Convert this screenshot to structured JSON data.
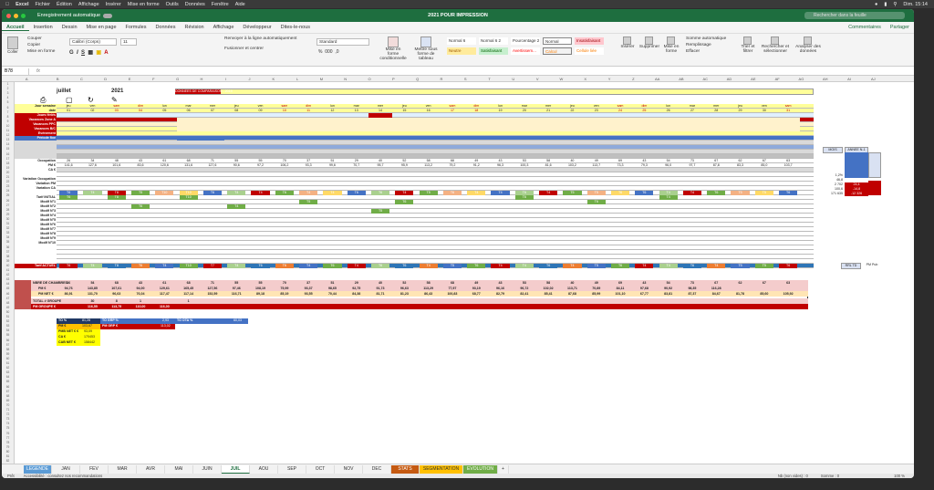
{
  "menubar": {
    "app": "Excel",
    "items": [
      "Fichier",
      "Édition",
      "Affichage",
      "Insérer",
      "Mise en forme",
      "Outils",
      "Données",
      "Fenêtre",
      "Aide"
    ],
    "clock": "Dim. 15:14"
  },
  "titlebar": {
    "autosave": "Enregistrement automatique",
    "title": "2021 POUR IMPRESSION",
    "search_placeholder": "Rechercher dans la feuille"
  },
  "ribbon_tabs": [
    "Accueil",
    "Insertion",
    "Dessin",
    "Mise en page",
    "Formules",
    "Données",
    "Révision",
    "Affichage",
    "Développeur",
    "Dites-le-nous"
  ],
  "ribbon_right": {
    "comments": "Commentaires",
    "share": "Partager"
  },
  "ribbon": {
    "paste": "Coller",
    "cut": "Couper",
    "copy": "Copier",
    "format_painter": "Mise en forme",
    "font_name": "Calibri (Corps)",
    "font_size": "11",
    "wrap_text": "Renvoyer à la ligne automatiquement",
    "merge": "Fusionner et centrer",
    "number_format": "Standard",
    "cond_format": "Mise en forme conditionnelle",
    "table_format": "Mettre sous forme de tableau",
    "styles": [
      "Normal 6",
      "Normal 6 2",
      "Pourcentage 2",
      "Normal",
      "Insatisfaisant",
      "Neutre",
      "Satisfaisant",
      "Avertissem...",
      "Calcul",
      "Cellule liée"
    ],
    "insert": "Insérer",
    "delete": "Supprimer",
    "format": "Mise en forme",
    "autosum": "Somme automatique",
    "fill": "Remplissage",
    "clear": "Effacer",
    "sort": "Trier et filtrer",
    "find": "Rechercher et sélectionner",
    "analyze": "Analyser des données"
  },
  "formula_bar": {
    "name_box": "B78",
    "fx": "fx"
  },
  "sheet": {
    "month": "juillet",
    "year": "2021",
    "compare_banner": "DONNEES DE COMPARAISON - 2019",
    "row_labels": [
      "Jour semaine",
      "date",
      "Jours fériés",
      "Vacances Zone A",
      "Vacances PPC",
      "Vacances B/C",
      "Evénement",
      "Période fixe",
      "",
      "",
      "",
      "Occupation",
      "PM €",
      "CA €",
      "",
      "Variation Occupation",
      "Variation PM",
      "Variation CA",
      "",
      "Tarif INITIAL",
      "Modif N°1",
      "Modif N°2",
      "Modif N°3",
      "Modif N°4",
      "Modif N°5",
      "Modif N°6",
      "Modif N°7",
      "Modif N°8",
      "Modif N°9",
      "Modif N°10",
      "",
      "Tarif ACTUEL"
    ],
    "days": [
      "jeu",
      "ven",
      "sam",
      "dim",
      "lun",
      "mar",
      "mer",
      "jeu",
      "ven",
      "sam",
      "dim",
      "lun",
      "mar",
      "mer",
      "jeu",
      "ven",
      "sam",
      "dim",
      "lun",
      "mar",
      "mer",
      "jeu",
      "ven",
      "sam",
      "dim",
      "lun",
      "mar",
      "mer",
      "jeu",
      "ven",
      "sam"
    ],
    "dates": [
      "01",
      "02",
      "03",
      "04",
      "05",
      "06",
      "07",
      "08",
      "09",
      "10",
      "11",
      "12",
      "13",
      "14",
      "15",
      "16",
      "17",
      "18",
      "19",
      "20",
      "21",
      "22",
      "23",
      "24",
      "25",
      "26",
      "27",
      "28",
      "29",
      "30",
      "31"
    ],
    "occupancy": [
      "26",
      "34",
      "48",
      "43",
      "61",
      "68",
      "71",
      "55",
      "55",
      "70",
      "37",
      "51",
      "29",
      "40",
      "52",
      "58",
      "68",
      "49",
      "43",
      "53",
      "58",
      "40",
      "49",
      "69",
      "43",
      "54",
      "73",
      "67",
      "62",
      "67",
      "63"
    ],
    "pm": [
      "141,6",
      "127,6",
      "101,6",
      "83,6",
      "120,6",
      "131,6",
      "127,6",
      "90,6",
      "97,2",
      "106,2",
      "93,3",
      "99,6",
      "70,7",
      "95,7",
      "95,9",
      "113,2",
      "79,2",
      "91,2",
      "96,3",
      "100,3",
      "81,6",
      "103,2",
      "113,7",
      "73,3",
      "79,3",
      "96,0",
      "97,7",
      "87,8",
      "83,3",
      "85,0",
      "103,7"
    ],
    "tarif_codes": [
      "T6",
      "T4",
      "T8",
      "T5",
      "T10",
      "T10",
      "T6",
      "T4",
      "T4",
      "T6",
      "T4",
      "T4",
      "T6",
      "T6",
      "T4",
      "T5",
      "T6",
      "T4",
      "T4",
      "T6",
      "T4",
      "T5",
      "T5",
      "T6",
      "T6",
      "T4",
      "T4",
      "T6",
      "T5",
      "T5",
      "T6"
    ],
    "tarif_actuel": [
      "T6",
      "T4",
      "T8",
      "T6",
      "T4",
      "T10",
      "T7",
      "T4",
      "T6",
      "T6",
      "T4",
      "T6",
      "T4",
      "T6",
      "T6",
      "T4",
      "T5",
      "T6",
      "T4",
      "T4",
      "T6",
      "T4",
      "T5",
      "T6",
      "T4",
      "T4",
      "T6",
      "T4",
      "T5",
      "T5",
      "T6"
    ],
    "side_header": {
      "mois": "MOIS",
      "annee": "ANNEE N-1"
    },
    "side_values": [
      "1,2%",
      "46,8",
      "2 702",
      "100,6",
      "171 635"
    ],
    "side_variation": [
      "24,4",
      "-14,8",
      "-12 326"
    ],
    "side_bottom": [
      "RRL TD",
      "PM Pub"
    ],
    "summary_rows": {
      "chambres_label": "NBRE DE CHAMBRES",
      "chambres": [
        "36",
        "54",
        "68",
        "43",
        "61",
        "68",
        "71",
        "55",
        "55",
        "70",
        "37",
        "51",
        "29",
        "40",
        "52",
        "58",
        "68",
        "49",
        "43",
        "53",
        "58",
        "40",
        "49",
        "69",
        "43",
        "54",
        "73",
        "67",
        "62",
        "67",
        "63"
      ],
      "pm_label": "PM €",
      "pm": [
        "94,76",
        "143,85",
        "107,61",
        "94,00",
        "129,61",
        "165,45",
        "127,56",
        "97,46",
        "108,19",
        "75,99",
        "93,37",
        "98,65",
        "92,75",
        "91,73",
        "96,63",
        "113,29",
        "77,97",
        "93,19",
        "96,16",
        "96,72",
        "102,02",
        "113,71",
        "70,89",
        "84,11",
        "97,68",
        "90,92",
        "98,35",
        "116,28",
        "",
        "",
        ""
      ],
      "pmnet_label": "PM NET €",
      "pmnet": [
        "86,91",
        "131,70",
        "96,63",
        "76,04",
        "117,47",
        "117,14",
        "152,59",
        "116,71",
        "89,18",
        "85,19",
        "93,55",
        "70,44",
        "84,38",
        "81,71",
        "81,23",
        "86,43",
        "100,83",
        "68,77",
        "82,79",
        "82,41",
        "85,41",
        "87,68",
        "85,99",
        "101,10",
        "67,77",
        "83,81",
        "87,37",
        "84,67",
        "81,78",
        "85,60",
        "105,92"
      ],
      "total_label": "TOTAL # GROUPE",
      "total": [
        "",
        "30",
        "8",
        "1",
        "",
        "1",
        "",
        "",
        "",
        "",
        "",
        "",
        "",
        "",
        "",
        "",
        "",
        "",
        "",
        "",
        "",
        "",
        "",
        "",
        "",
        "",
        "",
        "",
        "",
        "",
        ""
      ],
      "pmgroupe_label": "PM GROUPE €",
      "pmgroupe": [
        "",
        "116,55",
        "113,75",
        "110,00",
        "116,00",
        "",
        "",
        "",
        "",
        "",
        "",
        "",
        "",
        "",
        "",
        "",
        "",
        "",
        "",
        "",
        "",
        "",
        "",
        "",
        "",
        "",
        "",
        "",
        "",
        "",
        ""
      ]
    },
    "kpi": [
      {
        "label": "TO %",
        "value": "81,28",
        "label2": "TO GRP %",
        "value2": "2,93",
        "label3": "TO OTA %",
        "value3": "60,03"
      },
      {
        "label": "PM €",
        "value": "103,67",
        "label2": "PM GRP €",
        "value2": "113,02"
      },
      {
        "label": "PMB NET € €",
        "value": "93,09"
      },
      {
        "label": "CA €",
        "value": "170453"
      },
      {
        "label": "CAB NET €",
        "value": "158442"
      }
    ]
  },
  "sheet_tabs": [
    "LEGENDE",
    "JAN",
    "FEV",
    "MAR",
    "AVR",
    "MAI",
    "JUIN",
    "JUIL",
    "AOU",
    "SEP",
    "OCT",
    "NOV",
    "DEC",
    "STATS",
    "SEGMENTATION",
    "EVOLUTION",
    "+"
  ],
  "status": {
    "ready": "Prêt",
    "accessibility": "Accessibilité : consultez nos recommandations",
    "count": "Nb (non vides) : 0",
    "sum": "Somme : 0",
    "zoom": "100 %"
  },
  "colors": {
    "excel_green": "#1e6e3f",
    "header_yellow": "#ffff99",
    "blue_bar": "#4472c4",
    "dark_band": "#203864",
    "red_band": "#c0504d",
    "pink_band": "#f4cccc"
  }
}
